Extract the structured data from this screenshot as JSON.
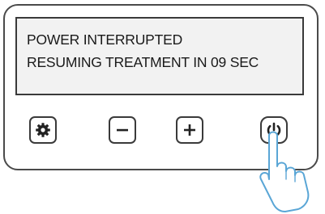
{
  "display": {
    "line1": "POWER INTERRUPTED",
    "line2": "RESUMING TREATMENT IN 09 SEC"
  },
  "buttons": [
    {
      "name": "settings",
      "icon": "gear-icon"
    },
    {
      "name": "decrease",
      "icon": "minus-icon"
    },
    {
      "name": "increase",
      "icon": "plus-icon"
    },
    {
      "name": "power",
      "icon": "power-icon"
    }
  ],
  "colors": {
    "border": "#3a3a3a",
    "display_background": "#f2f2f2",
    "hand_fill": "#ffffff",
    "hand_outline": "#5aa6d6"
  }
}
